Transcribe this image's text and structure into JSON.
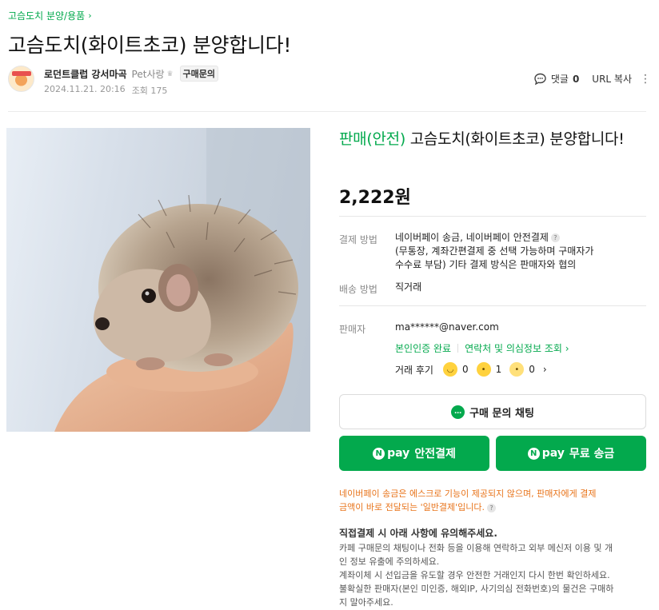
{
  "breadcrumb": {
    "label": "고슴도치 분양/용품"
  },
  "post": {
    "title": "고슴도치(화이트초코) 분양합니다!",
    "author": "로던트클럽 강서마곡",
    "author_level": "Pet사랑",
    "buy_badge": "구매문의",
    "date": "2024.11.21. 20:16",
    "views_label": "조회 175"
  },
  "actions": {
    "comment_label": "댓글",
    "comment_count": "0",
    "url_copy": "URL 복사"
  },
  "product": {
    "status": "판매(안전)",
    "title": "고슴도치(화이트초코) 분양합니다!",
    "price": "2,222원",
    "payment_label": "결제 방법",
    "payment_line1": "네이버페이 송금, 네이버페이 안전결제",
    "payment_line2": "(무통장, 계좌간편결제 중 선택 가능하며 구매자가",
    "payment_line3": "수수료 부담) 기타 결제 방식은 판매자와 협의",
    "shipping_label": "배송 방법",
    "shipping_value": "직거래",
    "seller_label": "판매자",
    "seller_email": "ma******@naver.com",
    "verified": "본인인증 완료",
    "contact_link": "연락처 및 의심정보 조회",
    "review_label": "거래 후기",
    "reviews": [
      "0",
      "1",
      "0"
    ]
  },
  "buttons": {
    "chat": "구매 문의 채팅",
    "npay_logo": "pay",
    "safe_pay": "안전결제",
    "free_transfer": "무료 송금"
  },
  "warning": {
    "line1": "네이버페이 송금은 에스크로 기능이 제공되지 않으며, 판매자에게 결제",
    "line2": "금액이 바로 전달되는 '일반결제'입니다."
  },
  "notice": {
    "title": "직접결제 시 아래 사항에 유의해주세요.",
    "lines": [
      "카페 구매문의 채팅이나 전화 등을 이용해 연락하고 외부 메신저 이용 및 개",
      "인 정보 유출에 주의하세요.",
      "계좌이체 시 선입금을 유도할 경우 안전한 거래인지 다시 한번 확인하세요.",
      "불확실한 판매자(본인 미인증, 해외IP, 사기의심 전화번호)의 물건은 구매하",
      "지 말아주세요."
    ]
  },
  "colors": {
    "accent": "#03a94d",
    "warning": "#e8741b"
  }
}
